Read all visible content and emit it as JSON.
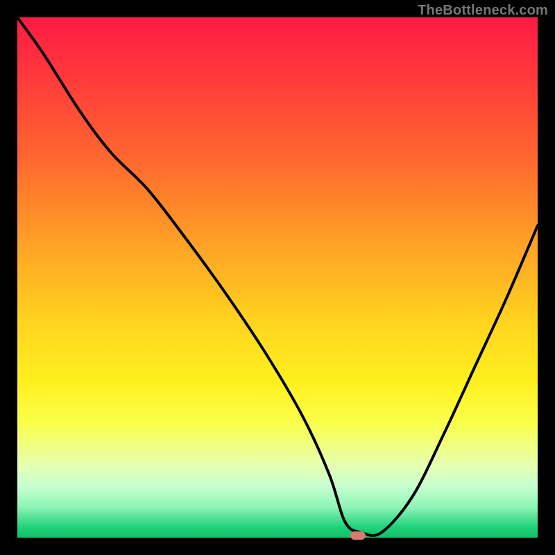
{
  "watermark": "TheBottleneck.com",
  "marker": {
    "x_pct": 65.5,
    "y_pct": 99.6
  },
  "colors": {
    "curve": "#000000",
    "marker": "#d87a70",
    "frame": "#000000"
  },
  "chart_data": {
    "type": "line",
    "title": "",
    "xlabel": "",
    "ylabel": "",
    "xlim": [
      0,
      100
    ],
    "ylim": [
      0,
      100
    ],
    "annotations": [
      "TheBottleneck.com"
    ],
    "legend": false,
    "grid": false,
    "series": [
      {
        "name": "bottleneck-curve",
        "x": [
          0,
          5,
          12,
          18,
          25,
          32,
          40,
          48,
          55,
          60,
          63,
          66,
          70,
          76,
          82,
          88,
          94,
          100
        ],
        "y": [
          100,
          93,
          82,
          74,
          67,
          58,
          47,
          35,
          23,
          12,
          3,
          1,
          1,
          8,
          20,
          33,
          46,
          60
        ]
      }
    ],
    "background_gradient_stops": [
      {
        "pct": 0,
        "color": "#ff1a44"
      },
      {
        "pct": 12,
        "color": "#ff3b3b"
      },
      {
        "pct": 28,
        "color": "#ff6a2e"
      },
      {
        "pct": 44,
        "color": "#ffa326"
      },
      {
        "pct": 58,
        "color": "#ffd21f"
      },
      {
        "pct": 70,
        "color": "#fff01f"
      },
      {
        "pct": 78,
        "color": "#faff4a"
      },
      {
        "pct": 86,
        "color": "#e6ffb0"
      },
      {
        "pct": 90,
        "color": "#c8ffd0"
      },
      {
        "pct": 94,
        "color": "#90f5b8"
      },
      {
        "pct": 98,
        "color": "#1fd27a"
      },
      {
        "pct": 100,
        "color": "#12c06a"
      }
    ],
    "marker_point": {
      "x": 65.5,
      "y": 0.4
    }
  }
}
